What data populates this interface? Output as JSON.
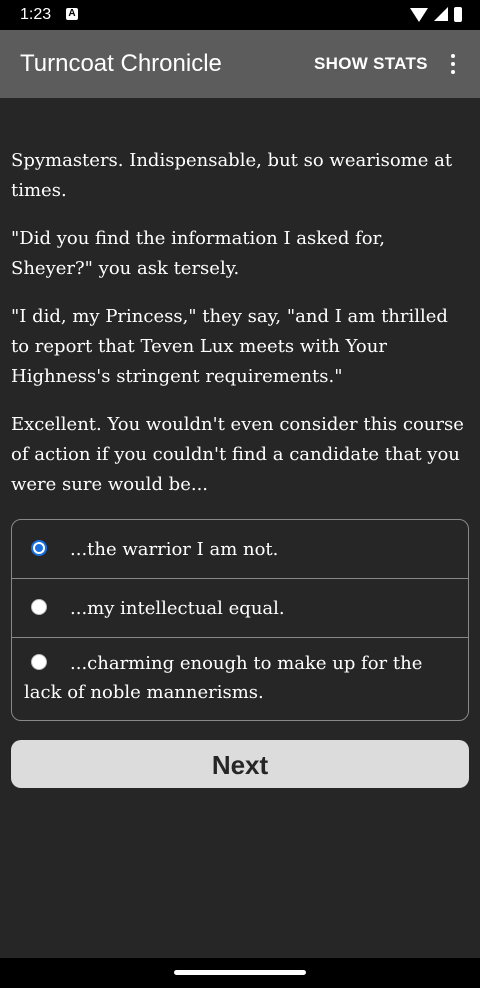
{
  "status_bar": {
    "time": "1:23",
    "notification_icon": "A"
  },
  "app_bar": {
    "title": "Turncoat Chronicle",
    "action": "SHOW STATS",
    "menu_icon": "more-vert-icon"
  },
  "story": {
    "paragraphs": [
      "Spymasters. Indispensable, but so wearisome at times.",
      "\"Did you find the information I asked for, Sheyer?\" you ask tersely.",
      "\"I did, my Princess,\" they say, \"and I am thrilled to report that Teven Lux meets with Your Highness's stringent requirements.\"",
      "Excellent. You wouldn't even consider this course of action if you couldn't find a candidate that you were sure would be..."
    ]
  },
  "choices": [
    {
      "label": "...the warrior I am not.",
      "selected": true
    },
    {
      "label": "...my intellectual equal.",
      "selected": false
    },
    {
      "label": "...charming enough to make up for the lack of noble mannerisms.",
      "selected": false
    }
  ],
  "next_label": "Next",
  "colors": {
    "accent": "#1a6fe0",
    "app_bar": "#5c5c5c",
    "background": "#262626"
  }
}
